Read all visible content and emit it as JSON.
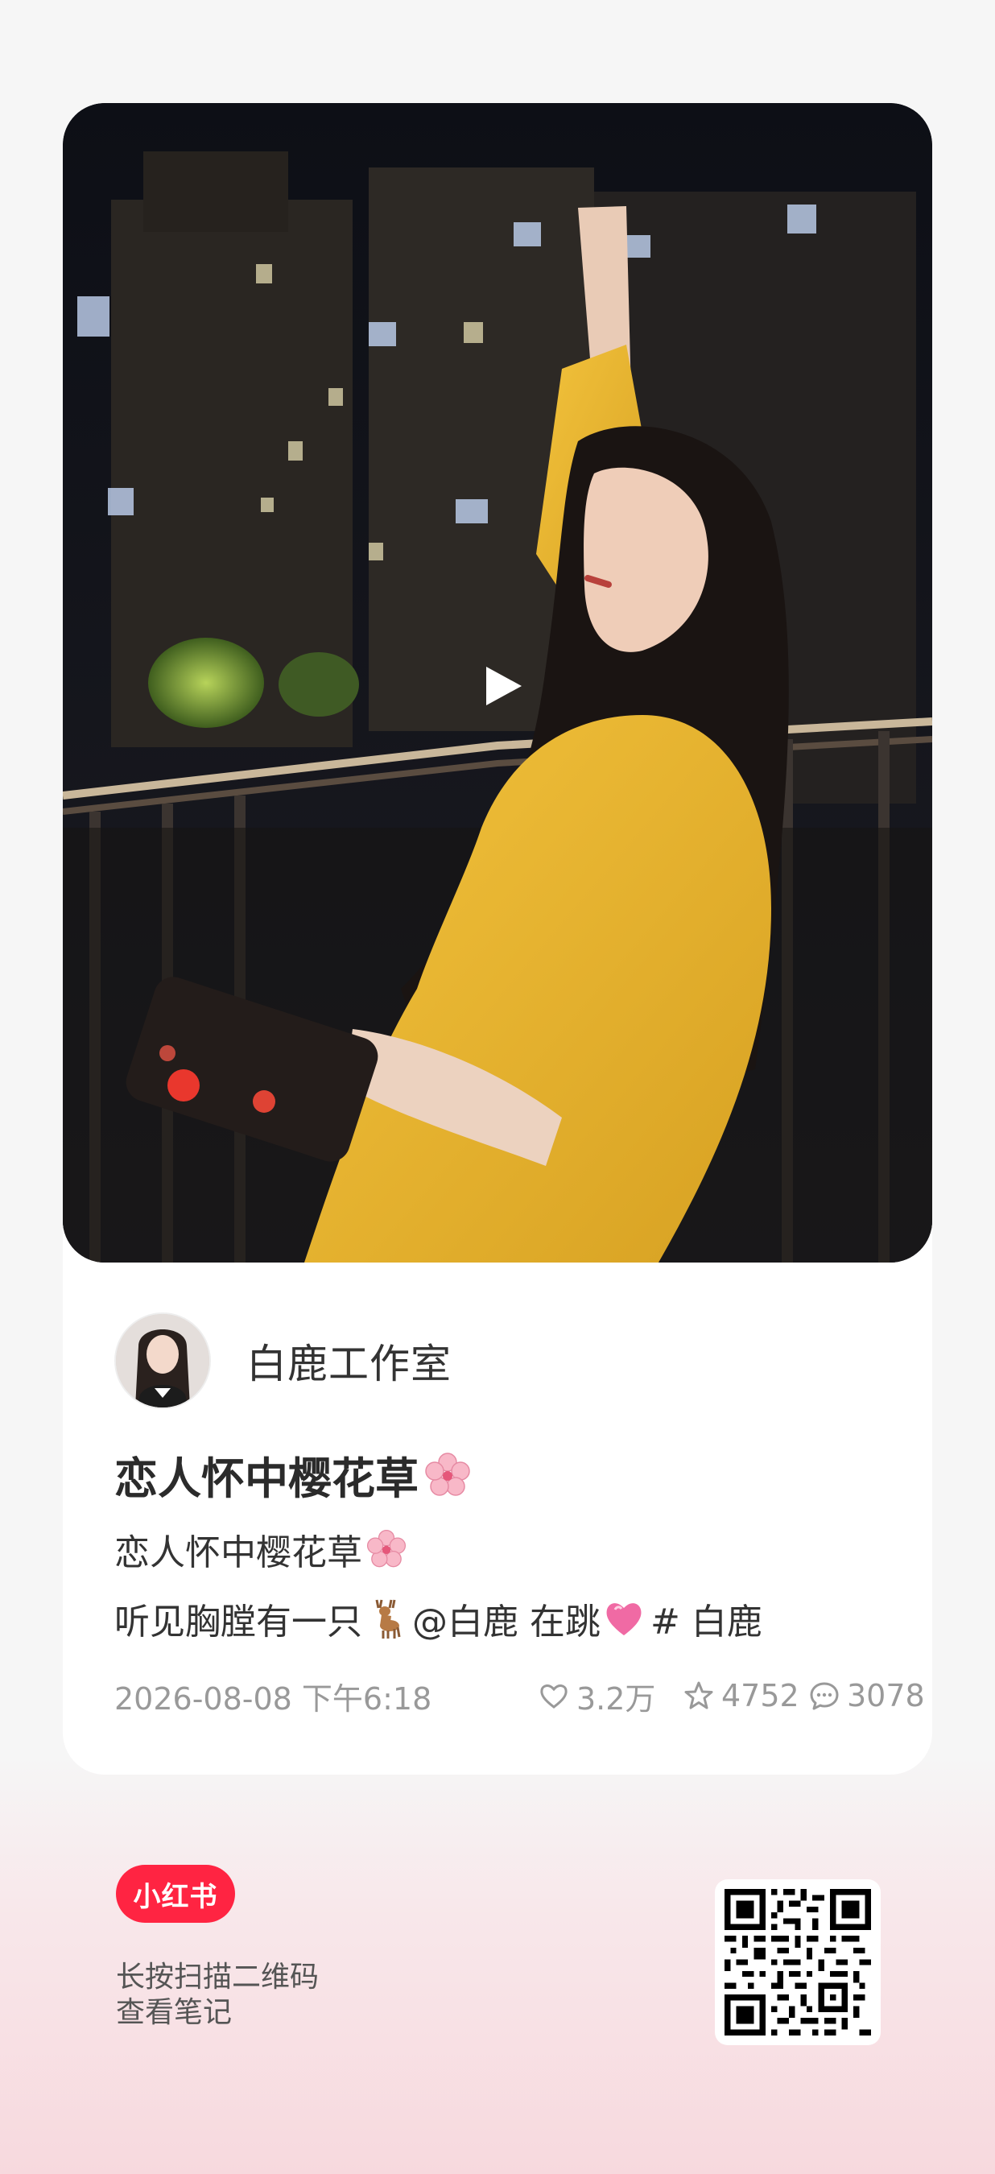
{
  "author": {
    "name": "白鹿工作室"
  },
  "note": {
    "title": "恋人怀中樱花草",
    "title_emoji": "cherry-blossom-icon",
    "desc_line1": "恋人怀中樱花草",
    "desc_line2_a": "听见胸膛有一只",
    "desc_line2_b": "@白鹿 在跳",
    "desc_line2_c": "# 白鹿",
    "date": "2026-08-08 下午6:18",
    "likes": "3.2万",
    "collects": "4752",
    "comments": "3078"
  },
  "footer": {
    "brand": "小红书",
    "scan_line1": "长按扫描二维码",
    "scan_line2": "查看笔记"
  },
  "colors": {
    "brand_red": "#ff2442",
    "text_dark": "#333333",
    "text_meta": "#999999"
  }
}
